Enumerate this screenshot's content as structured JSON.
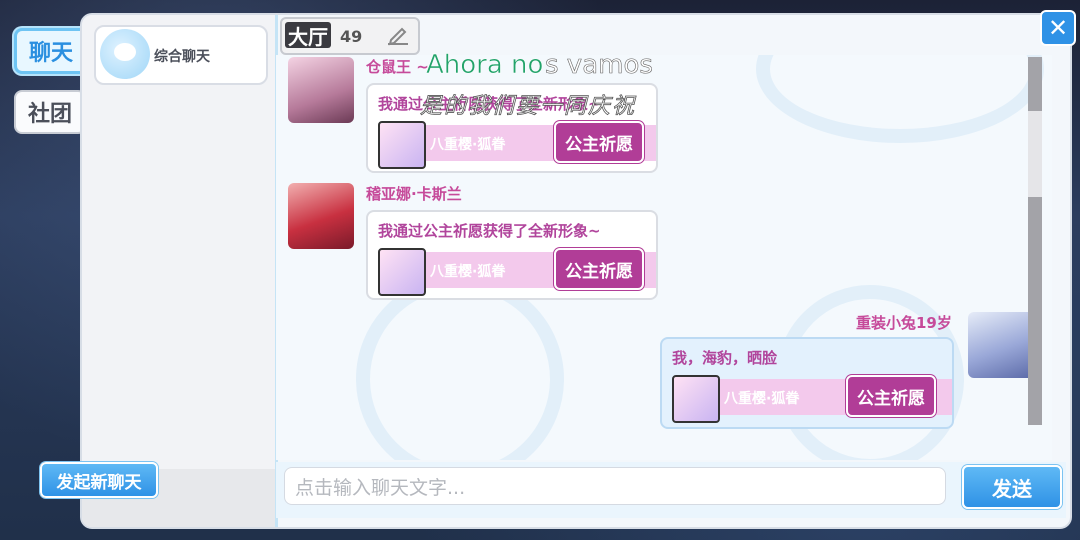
{
  "side_tabs": {
    "chat": "聊天",
    "club": "社团"
  },
  "channels": [
    {
      "label": "综合聊天"
    }
  ],
  "new_chat_label": "发起新聊天",
  "room": {
    "name": "大厅",
    "count": "49"
  },
  "messages": [
    {
      "sender": "仓鼠王 ~",
      "text": "我通过公主祈愿获得了全新形象~",
      "card_name": "八重樱·狐眷",
      "button": "公主祈愿",
      "self": false
    },
    {
      "sender": "稽亚娜·卡斯兰",
      "text": "我通过公主祈愿获得了全新形象~",
      "card_name": "八重樱·狐眷",
      "button": "公主祈愿",
      "self": false
    },
    {
      "sender": "重装小兔19岁",
      "text": "我，海豹，晒脸",
      "card_name": "八重樱·狐眷",
      "button": "公主祈愿",
      "self": true
    }
  ],
  "input": {
    "placeholder": "点击输入聊天文字..."
  },
  "send_label": "发送",
  "overlay": {
    "green": "Ahora no",
    "white": "s vamos",
    "chinese": "是的我们要一同庆祝"
  },
  "icons": {
    "close": "close-icon",
    "edit": "pencil-icon",
    "channel": "chat-bubble-icon"
  }
}
